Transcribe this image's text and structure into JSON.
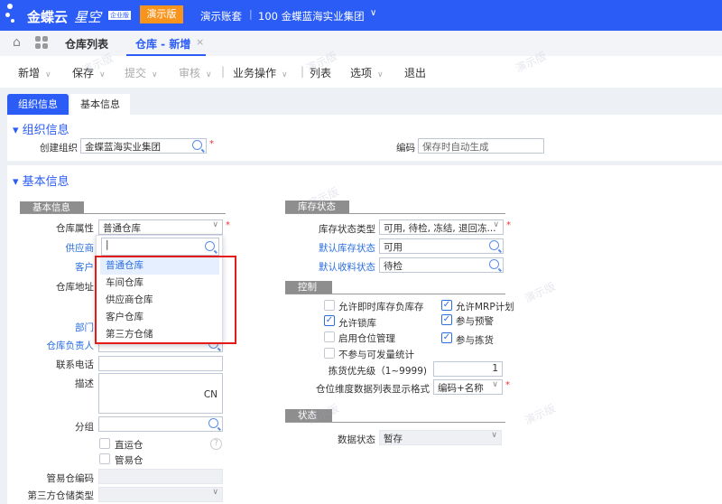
{
  "header": {
    "brand": "金蝶云",
    "brand2": "星空",
    "edition": "企业版",
    "demo_button": "演示版",
    "account_label": "演示账套",
    "account_org": "100 金蝶蓝海实业集团"
  },
  "tabs": [
    {
      "label": "仓库列表"
    },
    {
      "label": "仓库 - 新增"
    }
  ],
  "toolbar": {
    "new": "新增",
    "save": "保存",
    "submit": "提交",
    "audit": "审核",
    "business": "业务操作",
    "list": "列表",
    "options": "选项",
    "exit": "退出"
  },
  "subtabs": [
    {
      "label": "组织信息"
    },
    {
      "label": "基本信息"
    }
  ],
  "org_section": {
    "title": "组织信息",
    "create_org_label": "创建组织",
    "create_org_value": "金蝶蓝海实业集团",
    "code_label": "编码",
    "code_placeholder": "保存时自动生成"
  },
  "basic_section": {
    "title": "基本信息",
    "group_title": "基本信息",
    "fields": {
      "property_label": "仓库属性",
      "property_value": "普通仓库",
      "supplier_label": "供应商",
      "customer_label": "客户",
      "address_label": "仓库地址",
      "dept_label": "部门",
      "manager_label": "仓库负责人",
      "phone_label": "联系电话",
      "desc_label": "描述",
      "desc_lang": "CN",
      "group_label": "分组",
      "direct_label": "直运仓",
      "guanyi_label": "管易仓",
      "guanyi_code_label": "管易仓编码",
      "third_type_label": "第三方仓储类型"
    },
    "dropdown": {
      "search_value": "",
      "options": [
        "普通仓库",
        "车间仓库",
        "供应商仓库",
        "客户仓库",
        "第三方仓储"
      ],
      "selected": "普通仓库"
    }
  },
  "stock_status": {
    "title": "库存状态",
    "type_label": "库存状态类型",
    "type_value": "可用, 待检, 冻结, 退回冻...",
    "default_stock_label": "默认库存状态",
    "default_stock_value": "可用",
    "default_receive_label": "默认收料状态",
    "default_receive_value": "待检"
  },
  "control": {
    "title": "控制",
    "checks": [
      {
        "label": "允许即时库存负库存",
        "checked": false
      },
      {
        "label": "允许锁库",
        "checked": true
      },
      {
        "label": "启用仓位管理",
        "checked": false
      },
      {
        "label": "不参与可发量统计",
        "checked": false
      },
      {
        "label": "允许MRP计划",
        "checked": true
      },
      {
        "label": "参与预警",
        "checked": true
      },
      {
        "label": "参与拣货",
        "checked": true
      }
    ],
    "priority_label": "拣货优先级（1~9999)",
    "priority_value": "1",
    "format_label": "仓位维度数据列表显示格式",
    "format_value": "编码+名称"
  },
  "status": {
    "title": "状态",
    "data_status_label": "数据状态",
    "data_status_value": "暂存"
  },
  "watermark": "演示版",
  "colors": {
    "primary": "#2b5cf6",
    "demo": "#f7941d",
    "highlight": "#e6efff",
    "red_box": "#e31b1b"
  }
}
